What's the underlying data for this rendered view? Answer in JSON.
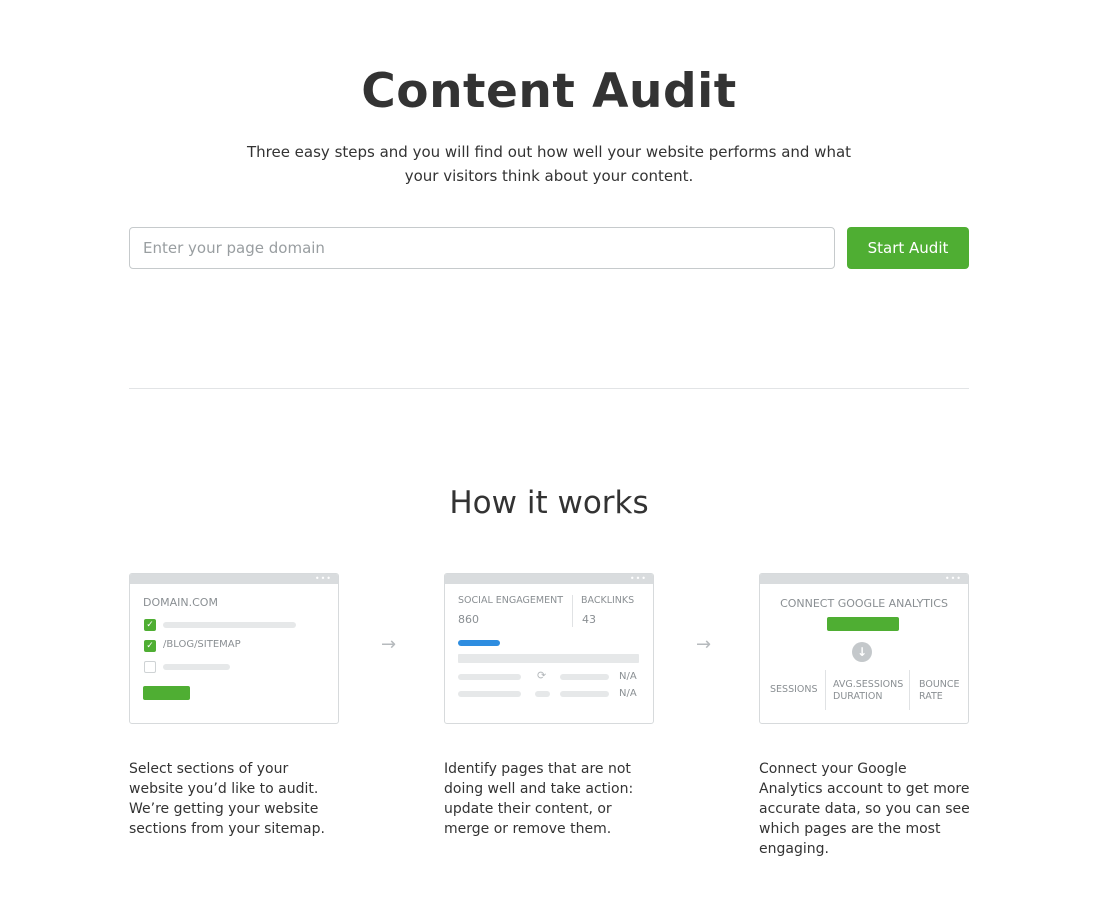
{
  "header": {
    "title": "Content Audit",
    "subtitle": "Three easy steps and you will find out how well your website performs and what your visitors think about your content."
  },
  "search": {
    "placeholder": "Enter your page domain",
    "value": "",
    "button_label": "Start Audit"
  },
  "how_it_works": {
    "title": "How it works",
    "steps": [
      {
        "card": {
          "domain": "DOMAIN.COM",
          "sitemap_label": "/BLOG/SITEMAP"
        },
        "description": "Select sections of your website you’d like to audit. We’re getting your website sections from your sitemap."
      },
      {
        "card": {
          "social_label": "SOCIAL ENGAGEMENT",
          "social_value": "860",
          "backlinks_label": "BACKLINKS",
          "backlinks_value": "43",
          "na_1": "N/A",
          "na_2": "N/A"
        },
        "description": "Identify pages that are not doing well and take action: update their content, or merge or remove them."
      },
      {
        "card": {
          "connect_label": "CONNECT GOOGLE ANALYTICS",
          "sessions_label": "SESSIONS",
          "avg_label": "AVG.SESSIONS DURATION",
          "bounce_label": "BOUNCE RATE"
        },
        "description": "Connect your Google Analytics account to get more accurate data, so you can see which pages are the most engaging."
      }
    ]
  },
  "icons": {
    "window_dots": "•••",
    "checkmark": "✓",
    "arrow": "→",
    "refresh": "⟳",
    "down_arrow": "↓"
  },
  "colors": {
    "accent_green": "#4fae33",
    "blue": "#2e8de0",
    "text": "#333333"
  }
}
